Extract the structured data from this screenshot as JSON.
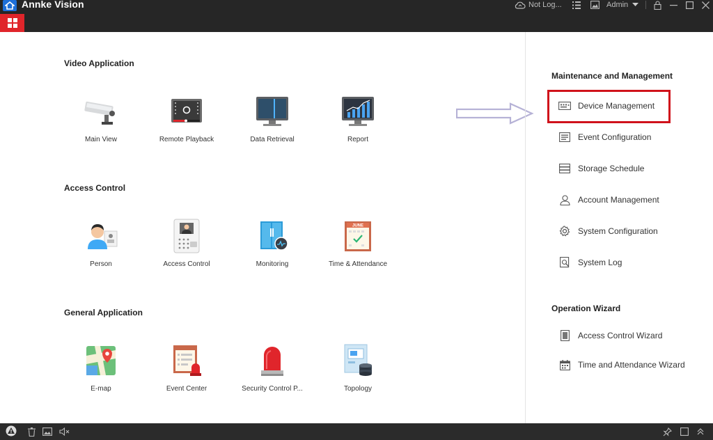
{
  "app": {
    "title": "Annke Vision"
  },
  "titlebar": {
    "cloud_status": "Not Log...",
    "user": "Admin"
  },
  "sections": {
    "video": {
      "title": "Video Application",
      "items": [
        {
          "label": "Main View",
          "icon": "camera-icon"
        },
        {
          "label": "Remote Playback",
          "icon": "playback-icon"
        },
        {
          "label": "Data Retrieval",
          "icon": "data-retrieval-icon"
        },
        {
          "label": "Report",
          "icon": "report-chart-icon"
        }
      ]
    },
    "access": {
      "title": "Access Control",
      "items": [
        {
          "label": "Person",
          "icon": "person-icon"
        },
        {
          "label": "Access Control",
          "icon": "door-station-icon"
        },
        {
          "label": "Monitoring",
          "icon": "door-monitor-icon"
        },
        {
          "label": "Time & Attendance",
          "icon": "calendar-icon",
          "badge": "JUNE"
        }
      ]
    },
    "general": {
      "title": "General Application",
      "items": [
        {
          "label": "E-map",
          "icon": "map-icon"
        },
        {
          "label": "Event Center",
          "icon": "event-center-icon"
        },
        {
          "label": "Security Control P...",
          "icon": "alarm-siren-icon"
        },
        {
          "label": "Topology",
          "icon": "topology-icon"
        }
      ]
    }
  },
  "right_panel": {
    "maintenance_title": "Maintenance and Management",
    "maintenance_items": [
      {
        "label": "Device Management",
        "icon": "device-icon"
      },
      {
        "label": "Event Configuration",
        "icon": "event-config-icon"
      },
      {
        "label": "Storage Schedule",
        "icon": "storage-icon"
      },
      {
        "label": "Account Management",
        "icon": "account-icon"
      },
      {
        "label": "System Configuration",
        "icon": "gear-icon"
      },
      {
        "label": "System Log",
        "icon": "log-icon"
      }
    ],
    "wizard_title": "Operation Wizard",
    "wizard_items": [
      {
        "label": "Access Control Wizard",
        "icon": "door-wizard-icon"
      },
      {
        "label": "Time and Attendance Wizard",
        "icon": "calendar-wizard-icon"
      }
    ]
  },
  "colors": {
    "titlebar": "#262626",
    "accent_red": "#e0252b",
    "highlight_red": "#d0121b",
    "statusbar": "#2b2b2b"
  }
}
